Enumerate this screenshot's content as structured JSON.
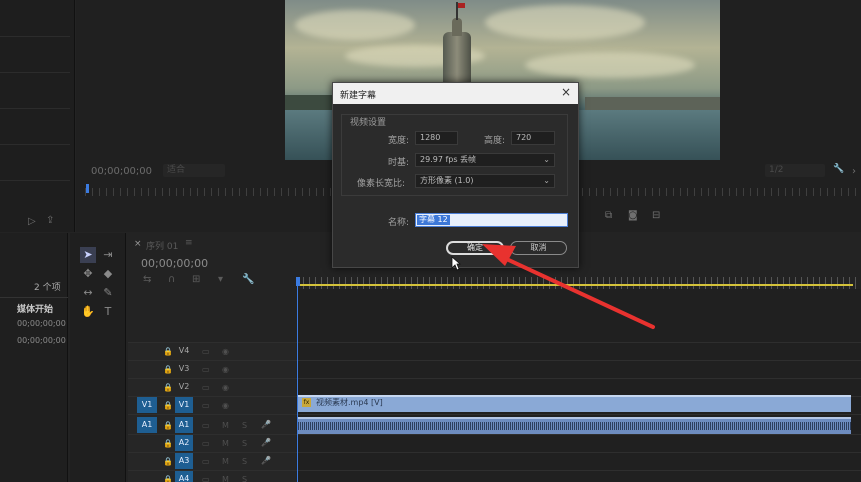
{
  "source_monitor": {
    "timecode": "00;00;00;00",
    "fit_label": "适合"
  },
  "program_monitor": {
    "fit_label": "1/2"
  },
  "project": {
    "item_count": "2 个项",
    "column_media_start": "媒体开始",
    "rows": [
      "00;00;00;00",
      "00;00;00;00"
    ]
  },
  "sequence": {
    "tab_label": "序列 01",
    "timecode": "00;00;00;00"
  },
  "tracks": {
    "video": [
      {
        "label": "V4",
        "active": false
      },
      {
        "label": "V3",
        "active": false
      },
      {
        "label": "V2",
        "active": false
      },
      {
        "label": "V1",
        "active": true,
        "source": "V1"
      }
    ],
    "audio": [
      {
        "label": "A1",
        "active": true,
        "source": "A1",
        "m": "M",
        "s": "S"
      },
      {
        "label": "A2",
        "active": true,
        "m": "M",
        "s": "S"
      },
      {
        "label": "A3",
        "active": true,
        "m": "M",
        "s": "S"
      },
      {
        "label": "A4",
        "active": true,
        "m": "M",
        "s": "S"
      }
    ]
  },
  "clip": {
    "fx": "fx",
    "video_label": "视频素材.mp4 [V]"
  },
  "dialog": {
    "title": "新建字幕",
    "close": "×",
    "group_label": "视频设置",
    "width_label": "宽度:",
    "width_value": "1280",
    "height_label": "高度:",
    "height_value": "720",
    "timebase_label": "时基:",
    "timebase_value": "29.97 fps 丢帧",
    "aspect_label": "像素长宽比:",
    "aspect_value": "方形像素 (1.0)",
    "name_label": "名称:",
    "name_value": "字幕 12",
    "ok_label": "确定",
    "cancel_label": "取消"
  },
  "annotation": {
    "arrow_color": "#e8322f"
  },
  "icons": [
    "close-icon",
    "chevron-down-icon",
    "selection-tool-icon",
    "track-select-icon",
    "ripple-edit-icon",
    "razor-icon",
    "slip-icon",
    "pen-icon",
    "hand-icon",
    "type-icon",
    "wrench-icon",
    "lock-icon",
    "eye-icon",
    "film-icon",
    "mic-icon",
    "snap-icon",
    "marker-icon",
    "camera-icon",
    "export-icon"
  ]
}
